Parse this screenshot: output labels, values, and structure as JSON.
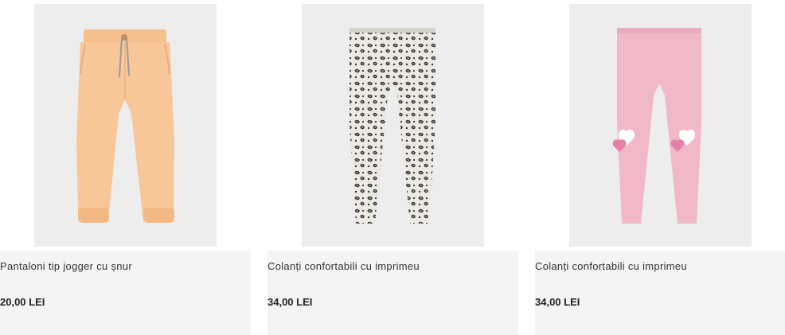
{
  "products": [
    {
      "title": "Pantaloni tip jogger cu șnur",
      "price": "20,00 LEI",
      "image_icon": "jogger-pants-image",
      "color": "#f7c79a"
    },
    {
      "title": "Colanți confortabili cu imprimeu",
      "price": "34,00 LEI",
      "image_icon": "leopard-leggings-image",
      "color": "#ebe9e1"
    },
    {
      "title": "Colanți confortabili cu imprimeu",
      "price": "34,00 LEI",
      "image_icon": "pink-heart-leggings-image",
      "color": "#f1b8c8"
    }
  ]
}
